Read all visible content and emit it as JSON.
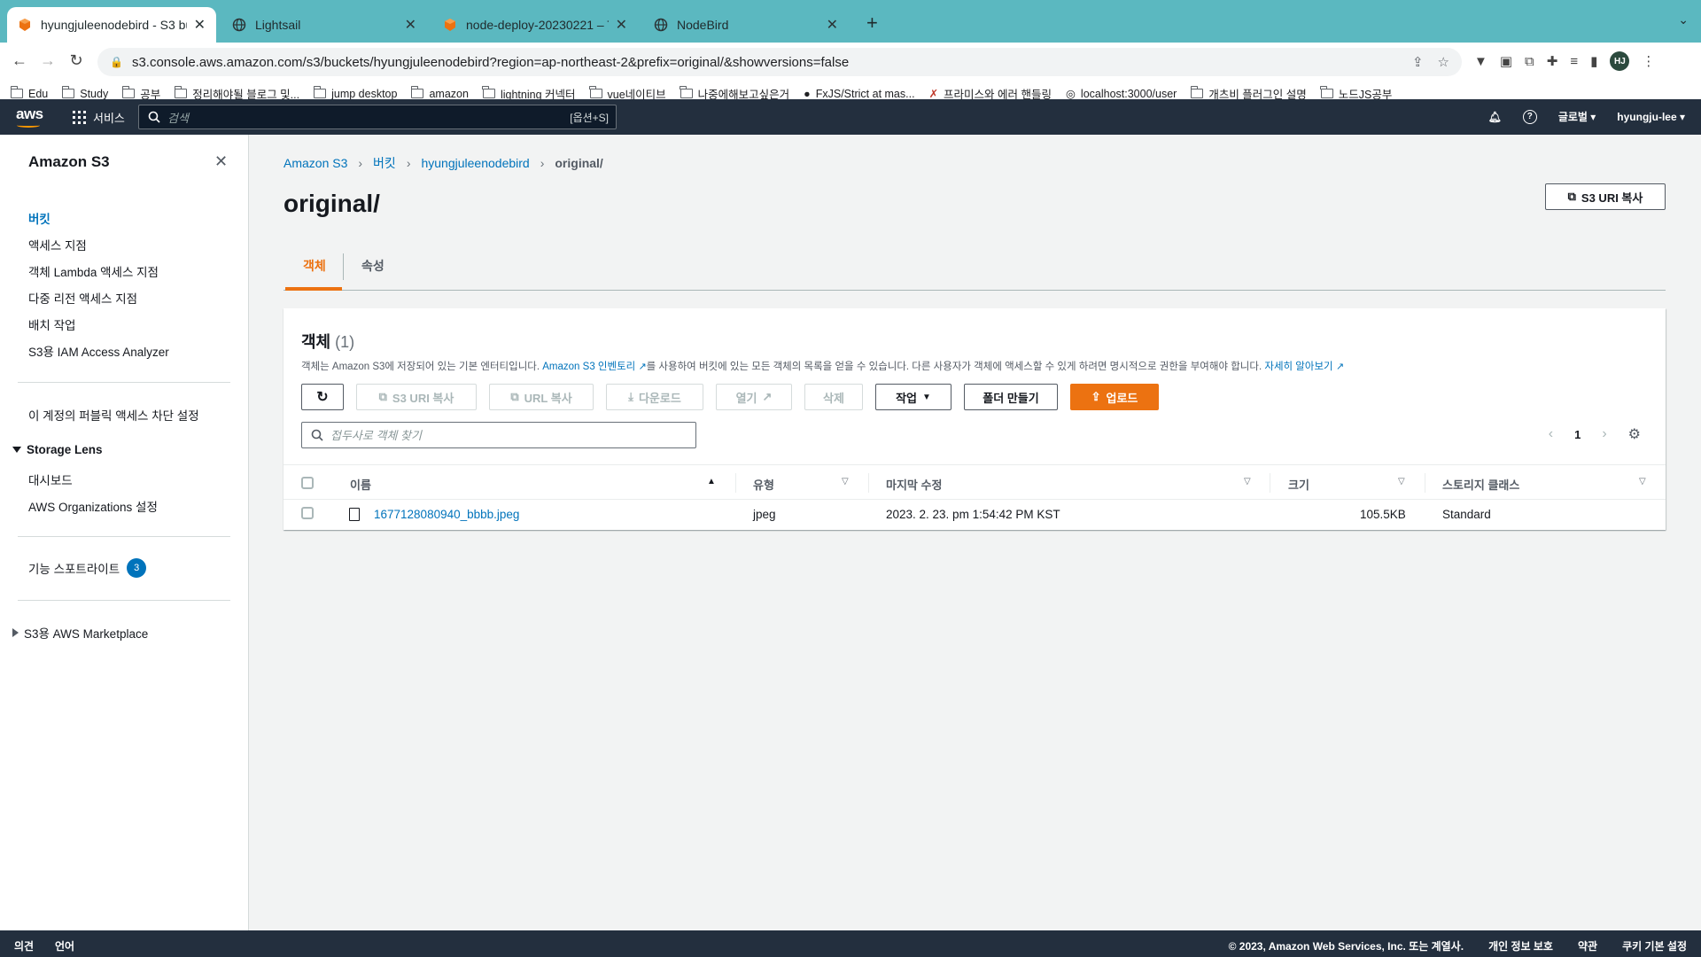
{
  "browser": {
    "tabs": [
      {
        "title": "hyungjuleenodebird - S3 bucke",
        "favicon": "aws-box-icon",
        "active": true
      },
      {
        "title": "Lightsail",
        "favicon": "globe-icon",
        "active": false
      },
      {
        "title": "node-deploy-20230221 – Term",
        "favicon": "aws-box-icon",
        "active": false
      },
      {
        "title": "NodeBird",
        "favicon": "globe-icon",
        "active": false
      }
    ],
    "url": "s3.console.aws.amazon.com/s3/buckets/hyungjuleenodebird?region=ap-northeast-2&prefix=original/&showversions=false",
    "profile_initials": "HJ",
    "bookmarks": [
      {
        "label": "Edu",
        "type": "folder"
      },
      {
        "label": "Study",
        "type": "folder"
      },
      {
        "label": "공부",
        "type": "folder"
      },
      {
        "label": "정리해야될 블로그 및...",
        "type": "folder"
      },
      {
        "label": "jump desktop",
        "type": "folder"
      },
      {
        "label": "amazon",
        "type": "folder"
      },
      {
        "label": "lightning 커넥터",
        "type": "folder"
      },
      {
        "label": "vue네이티브",
        "type": "folder"
      },
      {
        "label": "나중에해보고싶은거",
        "type": "folder"
      },
      {
        "label": "FxJS/Strict at mas...",
        "type": "github"
      },
      {
        "label": "프라미스와 에러 핸들링",
        "type": "link"
      },
      {
        "label": "localhost:3000/user",
        "type": "globe"
      },
      {
        "label": "개츠비 플러그인 설명",
        "type": "folder"
      },
      {
        "label": "노드JS공부",
        "type": "folder"
      }
    ]
  },
  "aws_header": {
    "logo": "aws",
    "services_label": "서비스",
    "search_placeholder": "검색",
    "search_shortcut": "[옵션+S]",
    "region_label": "글로벌",
    "user_label": "hyungju-lee"
  },
  "sidebar": {
    "title": "Amazon S3",
    "items": [
      {
        "label": "버킷",
        "active": true
      },
      {
        "label": "액세스 지점"
      },
      {
        "label": "객체 Lambda 액세스 지점"
      },
      {
        "label": "다중 리전 액세스 지점"
      },
      {
        "label": "배치 작업"
      },
      {
        "label": "S3용 IAM Access Analyzer"
      }
    ],
    "block_public_label": "이 계정의 퍼블릭 액세스 차단 설정",
    "storage_lens": {
      "label": "Storage Lens",
      "items": [
        "대시보드",
        "AWS Organizations 설정"
      ]
    },
    "feature_spotlight": {
      "label": "기능 스포트라이트",
      "badge": "3"
    },
    "marketplace_label": "S3용 AWS Marketplace"
  },
  "breadcrumb": [
    "Amazon S3",
    "버킷",
    "hyungjuleenodebird",
    "original/"
  ],
  "page": {
    "title": "original/",
    "copy_uri_label": "S3 URI 복사",
    "tabs": [
      "객체",
      "속성"
    ]
  },
  "objects": {
    "title": "객체",
    "count": "(1)",
    "desc_before": "객체는 Amazon S3에 저장되어 있는 기본 엔터티입니다.",
    "desc_link": "Amazon S3 인벤토리",
    "desc_after": "를 사용하여 버킷에 있는 모든 객체의 목록을 얻을 수 있습니다. 다른 사용자가 객체에 액세스할 수 있게 하려면 명시적으로 권한을 부여해야 합니다.",
    "learn_more": "자세히 알아보기",
    "actions": {
      "copy_s3_uri": "S3 URI 복사",
      "copy_url": "URL 복사",
      "download": "다운로드",
      "open": "열기",
      "delete": "삭제",
      "actions": "작업",
      "create_folder": "폴더 만들기",
      "upload": "업로드"
    },
    "filter_placeholder": "접두사로 객체 찾기",
    "page_number": "1",
    "columns": [
      "이름",
      "유형",
      "마지막 수정",
      "크기",
      "스토리지 클래스"
    ],
    "rows": [
      {
        "name": "1677128080940_bbbb.jpeg",
        "type": "jpeg",
        "modified": "2023. 2. 23. pm 1:54:42 PM KST",
        "size": "105.5KB",
        "storage_class": "Standard"
      }
    ]
  },
  "footer": {
    "feedback": "의견",
    "language": "언어",
    "copyright": "© 2023, Amazon Web Services, Inc. 또는 계열사.",
    "privacy": "개인 정보 보호",
    "terms": "약관",
    "cookies": "쿠키 기본 설정"
  },
  "colors": {
    "tabstrip": "#5bb8c0",
    "aws_header": "#232f3e",
    "link": "#0073bb",
    "accent": "#ec7211"
  }
}
